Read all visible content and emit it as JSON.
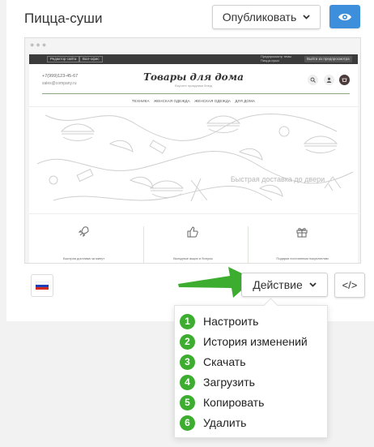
{
  "site": {
    "title": "Пицца-суши"
  },
  "toolbar": {
    "publish_label": "Опубликовать",
    "action_label": "Действие",
    "code_label": "</>"
  },
  "preview": {
    "topbar": {
      "edit_site": "Редактор сайта",
      "lk": "Вал-офис",
      "profile_line1": "Предпросмотр темы",
      "profile_line2": "Пицца-суши",
      "logout": "Выйти из предпросмотра"
    },
    "phone": "+7(999)123-45-67",
    "email": "sales@company.ru",
    "brand": "Товары для дома",
    "brand_sub": "Вкусите праздники блюд",
    "nav": [
      "ТЕХНИКА",
      "ЖЕНСКАЯ ОДЕЖДА",
      "ЖЕНСКАЯ ОДЕЖДА",
      "ДЛЯ ДОМА"
    ],
    "hero_text": "Быстрая доставка до двери",
    "features": [
      "Быстрая доставка за минут",
      "Выгодные акции и бонусы",
      "Подарки постоянным покупателям"
    ]
  },
  "dropdown": {
    "items": [
      {
        "num": "1",
        "label": "Настроить"
      },
      {
        "num": "2",
        "label": "История изменений"
      },
      {
        "num": "3",
        "label": "Скачать"
      },
      {
        "num": "4",
        "label": "Загрузить"
      },
      {
        "num": "5",
        "label": "Копировать"
      },
      {
        "num": "6",
        "label": "Удалить"
      }
    ]
  },
  "colors": {
    "accent": "#3d8fdb",
    "badge": "#3cad2f",
    "arrow": "#3cad2f",
    "topbar": "#3b3b3b"
  },
  "icons": {
    "eye": "eye-icon",
    "caret": "chevron-down-icon",
    "flag": "russia-flag-icon"
  }
}
